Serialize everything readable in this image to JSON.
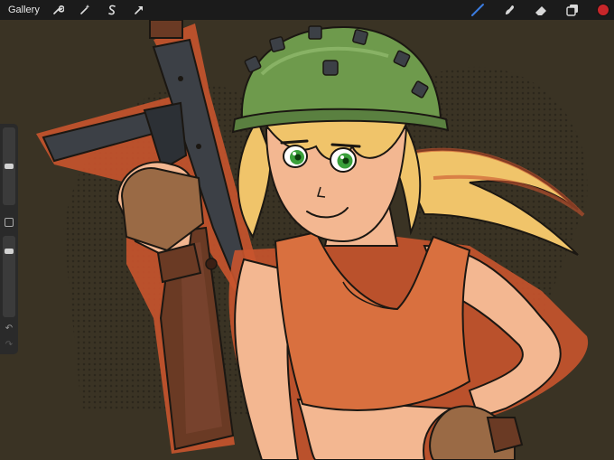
{
  "topbar": {
    "gallery_label": "Gallery",
    "left_tools": [
      "wrench-icon",
      "magic-wand-icon",
      "selection-icon",
      "transform-arrow-icon"
    ],
    "right_tools": [
      "brush-icon",
      "smudge-icon",
      "eraser-icon",
      "layers-icon"
    ],
    "active_tool": "brush-icon",
    "accent_color": "#3b7be0",
    "current_color": "#c8262a"
  },
  "sidebar": {
    "brush_size_level": 0.5,
    "opacity_level": 0.17,
    "icons": [
      "modify-button-icon",
      "undo-icon",
      "redo-icon"
    ]
  },
  "canvas": {
    "background_color": "#3a3324"
  }
}
